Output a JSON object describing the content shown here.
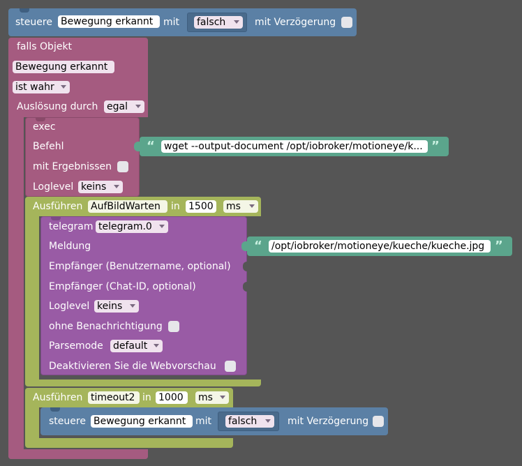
{
  "colors": {
    "background": "#555555",
    "steuere_block": "#5b80a5",
    "exec_block": "#a55b80",
    "timeout_block": "#a5b55b",
    "telegram_block": "#995ba5",
    "text_block": "#5ba58c"
  },
  "top_block": {
    "label": "steuere",
    "object": "Bewegung erkannt",
    "with_label": "mit",
    "value": "falsch",
    "delay_label": "mit Verzögerung"
  },
  "trigger": {
    "falls_objekt": "falls Objekt",
    "object": "Bewegung erkannt",
    "condition": "ist wahr",
    "ausloesung_label": "Auslösung durch",
    "ausloesung_value": "egal"
  },
  "exec": {
    "title": "exec",
    "befehl_label": "Befehl",
    "befehl_value": "wget --output-document /opt/iobroker/motioneye/k...",
    "ergebnisse_label": "mit Ergebnissen",
    "loglevel_label": "Loglevel",
    "loglevel_value": "keins"
  },
  "timeout1": {
    "label": "Ausführen",
    "name": "AufBildWarten",
    "in_label": "in",
    "delay": "1500",
    "unit": "ms"
  },
  "telegram": {
    "label": "telegram",
    "instance": "telegram.0",
    "meldung_label": "Meldung",
    "meldung_value": "/opt/iobroker/motioneye/kueche/kueche.jpg",
    "empf_user": "Empfänger (Benutzername, optional)",
    "empf_chat": "Empfänger (Chat-ID, optional)",
    "loglevel_label": "Loglevel",
    "loglevel_value": "keins",
    "ohne_label": "ohne Benachrichtigung",
    "parsemode_label": "Parsemode",
    "parsemode_value": "default",
    "deaktivieren_label": "Deaktivieren Sie die Webvorschau"
  },
  "timeout2": {
    "label": "Ausführen",
    "name": "timeout2",
    "in_label": "in",
    "delay": "1000",
    "unit": "ms"
  },
  "bottom_block": {
    "label": "steuere",
    "object": "Bewegung erkannt",
    "with_label": "mit",
    "value": "falsch",
    "delay_label": "mit Verzögerung"
  }
}
